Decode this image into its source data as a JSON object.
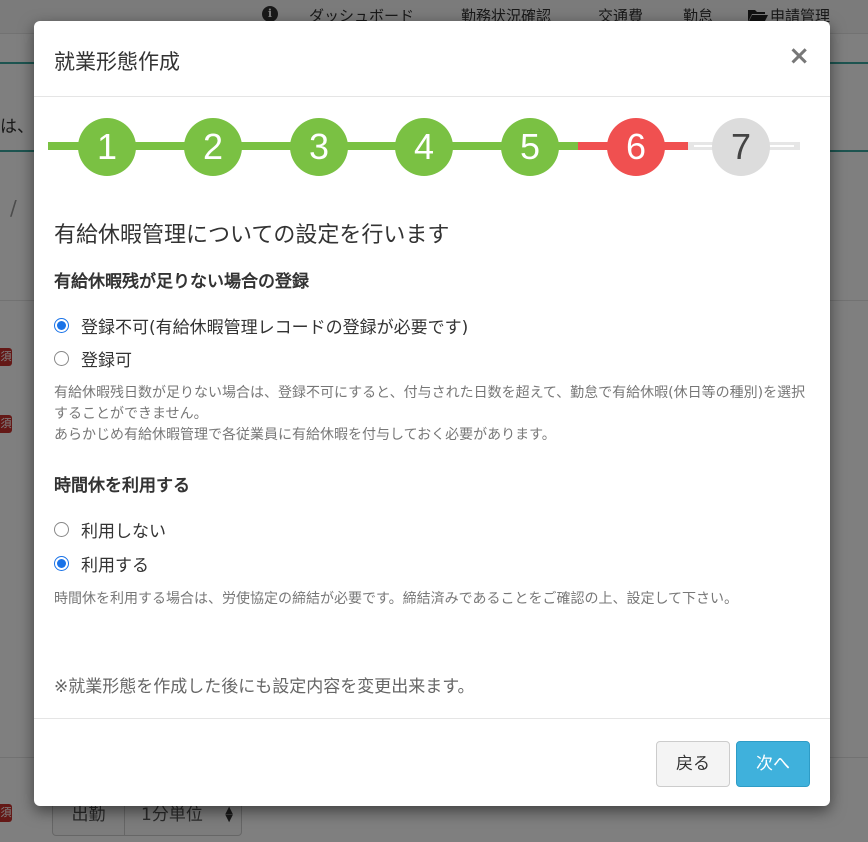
{
  "background": {
    "nav": {
      "items": [
        "ダッシュボード",
        "勤務状況確認",
        "交通費",
        "勤怠",
        "申請管理"
      ]
    },
    "partial_text": "は、",
    "breadcrumb_slash": "/",
    "required_badge": "須",
    "select": {
      "addon": "出勤",
      "value": "1分単位"
    }
  },
  "modal": {
    "title": "就業形態作成",
    "close": "×",
    "steps": [
      {
        "num": "1",
        "state": "done"
      },
      {
        "num": "2",
        "state": "done"
      },
      {
        "num": "3",
        "state": "done"
      },
      {
        "num": "4",
        "state": "done"
      },
      {
        "num": "5",
        "state": "done"
      },
      {
        "num": "6",
        "state": "current"
      },
      {
        "num": "7",
        "state": "todo"
      }
    ],
    "lead": "有給休暇管理についての設定を行います",
    "section1": {
      "heading": "有給休暇残が足りない場合の登録",
      "options": [
        {
          "label": "登録不可(有給休暇管理レコードの登録が必要です)",
          "checked": true
        },
        {
          "label": "登録可",
          "checked": false
        }
      ],
      "help": [
        "有給休暇残日数が足りない場合は、登録不可にすると、付与された日数を超えて、勤怠で有給休暇(休日等の種別)を選択することができません。",
        "あらかじめ有給休暇管理で各従業員に有給休暇を付与しておく必要があります。"
      ]
    },
    "section2": {
      "heading": "時間休を利用する",
      "options": [
        {
          "label": "利用しない",
          "checked": false
        },
        {
          "label": "利用する",
          "checked": true
        }
      ],
      "help": "時間休を利用する場合は、労使協定の締結が必要です。締結済みであることをご確認の上、設定して下さい。"
    },
    "footnote": "※就業形態を作成した後にも設定内容を変更出来ます。",
    "buttons": {
      "back": "戻る",
      "next": "次へ"
    }
  },
  "colors": {
    "step_done": "#7ac143",
    "step_current": "#f05050",
    "step_todo": "#dcdcdc",
    "primary_button": "#3fb1dc",
    "radio_checked": "#1a73e8",
    "accent_line": "#3aa9a0"
  }
}
